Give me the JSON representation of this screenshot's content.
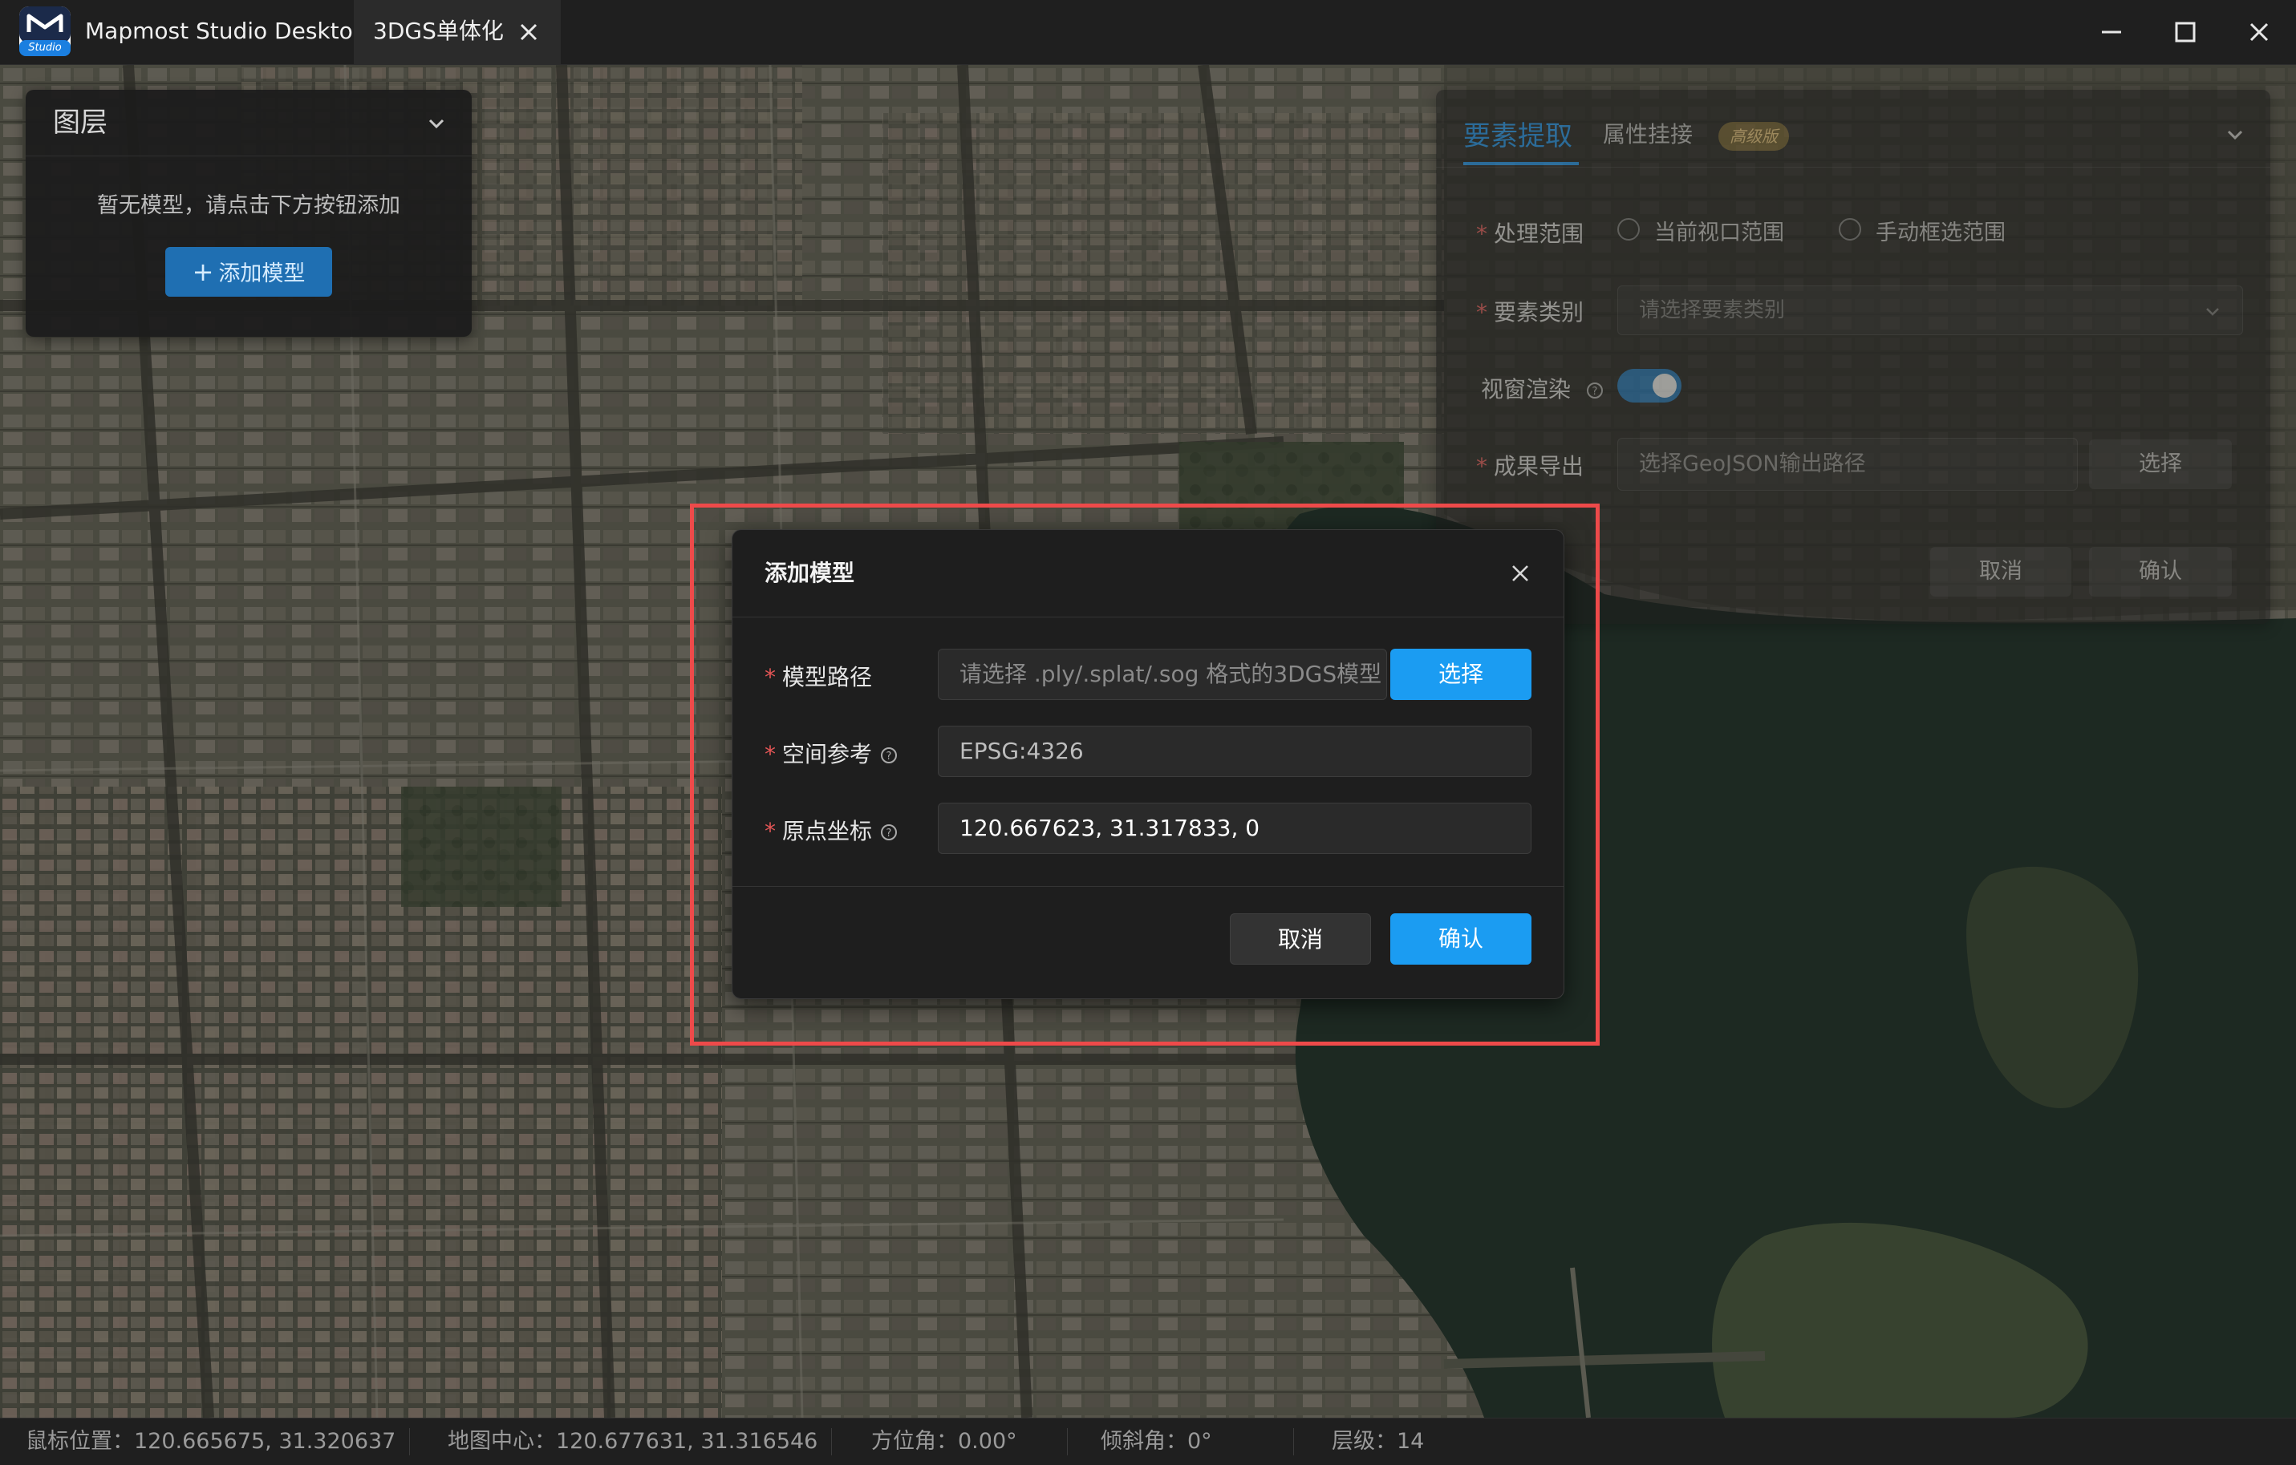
{
  "app": {
    "title": "Mapmost Studio Desktop",
    "logo_badge": "Studio"
  },
  "tab": {
    "label": "3DGS单体化"
  },
  "window_controls": {
    "minimize_icon": "minimize-icon",
    "maximize_icon": "maximize-icon",
    "close_icon": "close-icon"
  },
  "layer_panel": {
    "title": "图层",
    "empty_text": "暂无模型，请点击下方按钮添加",
    "add_button": "添加模型"
  },
  "right_panel": {
    "tab_active": "要素提取",
    "tab_secondary": "属性挂接",
    "badge": "高级版",
    "range_label": "处理范围",
    "range_option_1": "当前视口范围",
    "range_option_2": "手动框选范围",
    "category_label": "要素类别",
    "category_placeholder": "请选择要素类别",
    "render_label": "视窗渲染",
    "render_on": true,
    "export_label": "成果导出",
    "export_placeholder": "选择GeoJSON输出路径",
    "select_button": "选择",
    "cancel_button": "取消",
    "confirm_button": "确认"
  },
  "modal": {
    "title": "添加模型",
    "path_label": "模型路径",
    "path_placeholder": "请选择 .ply/.splat/.sog 格式的3DGS模型",
    "select_button": "选择",
    "crs_label": "空间参考",
    "crs_value": "EPSG:4326",
    "origin_label": "原点坐标",
    "origin_value": "120.667623, 31.317833, 0",
    "cancel_button": "取消",
    "confirm_button": "确认"
  },
  "status": {
    "mouse": "鼠标位置：120.665675, 31.320637",
    "center": "地图中心：120.677631, 31.316546",
    "bearing": "方位角：0.00°",
    "pitch": "倾斜角：0°",
    "zoom": "层级：14"
  },
  "colors": {
    "accent": "#1b9cf2",
    "highlight": "#ee4a4a",
    "required": "#e25555"
  }
}
